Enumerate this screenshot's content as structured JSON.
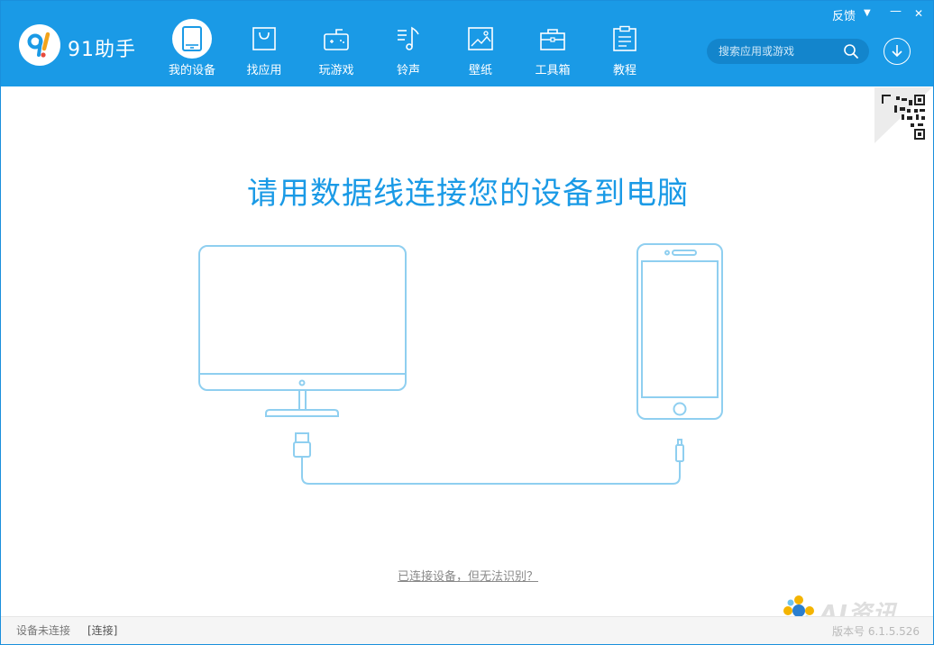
{
  "app": {
    "name": "91助手",
    "logo_glyph": "9!"
  },
  "header": {
    "nav": [
      {
        "label": "我的设备",
        "icon": "tablet-icon",
        "active": true
      },
      {
        "label": "找应用",
        "icon": "shopping-bag-icon",
        "active": false
      },
      {
        "label": "玩游戏",
        "icon": "gamepad-icon",
        "active": false
      },
      {
        "label": "铃声",
        "icon": "music-note-icon",
        "active": false
      },
      {
        "label": "壁纸",
        "icon": "image-icon",
        "active": false
      },
      {
        "label": "工具箱",
        "icon": "toolbox-icon",
        "active": false
      },
      {
        "label": "教程",
        "icon": "clipboard-icon",
        "active": false
      }
    ],
    "search_placeholder": "搜索应用或游戏",
    "feedback_label": "反馈",
    "dropdown_glyph": "▼",
    "minimize_glyph": "—",
    "close_glyph": "✕"
  },
  "main": {
    "title": "请用数据线连接您的设备到电脑",
    "help_link": "已连接设备，但无法识别？"
  },
  "status_bar": {
    "connection_status": "设备未连接",
    "connect_link": "[连接]",
    "version": "版本号 6.1.5.526"
  },
  "watermark": {
    "text": "AI资讯网"
  },
  "colors": {
    "brand": "#1a9ae6",
    "illustration_stroke": "#8fcff0",
    "title": "#1a9ae6"
  }
}
